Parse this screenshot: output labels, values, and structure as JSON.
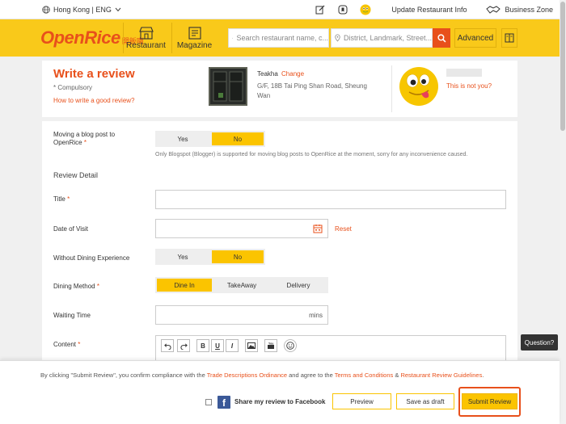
{
  "topbar": {
    "region": "Hong Kong | ENG",
    "update_restaurant": "Update Restaurant Info",
    "business_zone": "Business Zone"
  },
  "header": {
    "logo_main": "OpenRice",
    "logo_sub": "開飯喇",
    "nav_restaurant": "Restaurant",
    "nav_magazine": "Magazine",
    "search_restaurant_placeholder": "Search restaurant name, c...",
    "search_district_placeholder": "District, Landmark, Street...",
    "advanced": "Advanced",
    "accent": "#f9c91a",
    "brand": "#e8501b"
  },
  "intro": {
    "title": "Write a review",
    "compulsory": "* Compulsory",
    "how_to": "How to write a good review?",
    "restaurant_name": "Teakha",
    "change": "Change",
    "address": "G/F, 18B Tai Ping Shan Road, Sheung Wan",
    "not_you": "This is not you?"
  },
  "form": {
    "blog_label": "Moving a blog post to OpenRice",
    "blog_options": [
      "Yes",
      "No"
    ],
    "blog_note": "Only Blogspot (Blogger) is supported for moving blog posts to OpenRice at the moment, sorry for any inconvenience caused.",
    "section_title": "Review Detail",
    "title_label": "Title",
    "date_label": "Date of Visit",
    "reset": "Reset",
    "without_label": "Without Dining Experience",
    "without_options": [
      "Yes",
      "No"
    ],
    "dining_label": "Dining Method",
    "dining_options": [
      "Dine In",
      "TakeAway",
      "Delivery"
    ],
    "waiting_label": "Waiting Time",
    "waiting_unit": "mins",
    "content_label": "Content",
    "required_mark": "*"
  },
  "question_tab": "Question?",
  "footer": {
    "terms_prefix": "By clicking \"Submit Review\", you confirm compliance with the ",
    "terms_link1": "Trade Descriptions Ordinance",
    "terms_mid": " and agree to the ",
    "terms_link2": "Terms and Conditions",
    "terms_amp": " & ",
    "terms_link3": "Restaurant Review Guidelines",
    "terms_end": ".",
    "share_facebook": "Share my review to Facebook",
    "preview": "Preview",
    "save_draft": "Save as draft",
    "submit": "Submit Review"
  }
}
